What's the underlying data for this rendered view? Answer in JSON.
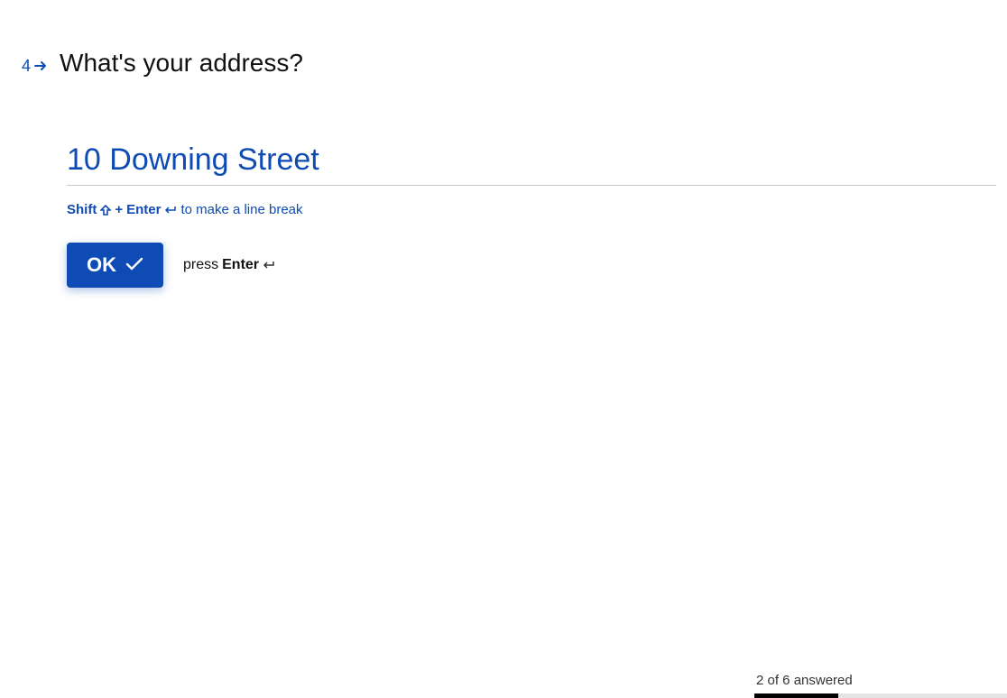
{
  "question": {
    "number": "4",
    "text": "What's your address?"
  },
  "answer": {
    "value": "10 Downing Street"
  },
  "hint": {
    "shift": "Shift",
    "plus": " + ",
    "enter": "Enter",
    "suffix": " to make a line break"
  },
  "action": {
    "ok_label": "OK",
    "press_prefix": "press ",
    "press_key": "Enter"
  },
  "progress": {
    "label": "2 of 6 answered",
    "answered": 2,
    "total": 6,
    "percent": "33.33%"
  },
  "colors": {
    "primary": "#0e4bb5",
    "text": "#111111"
  }
}
